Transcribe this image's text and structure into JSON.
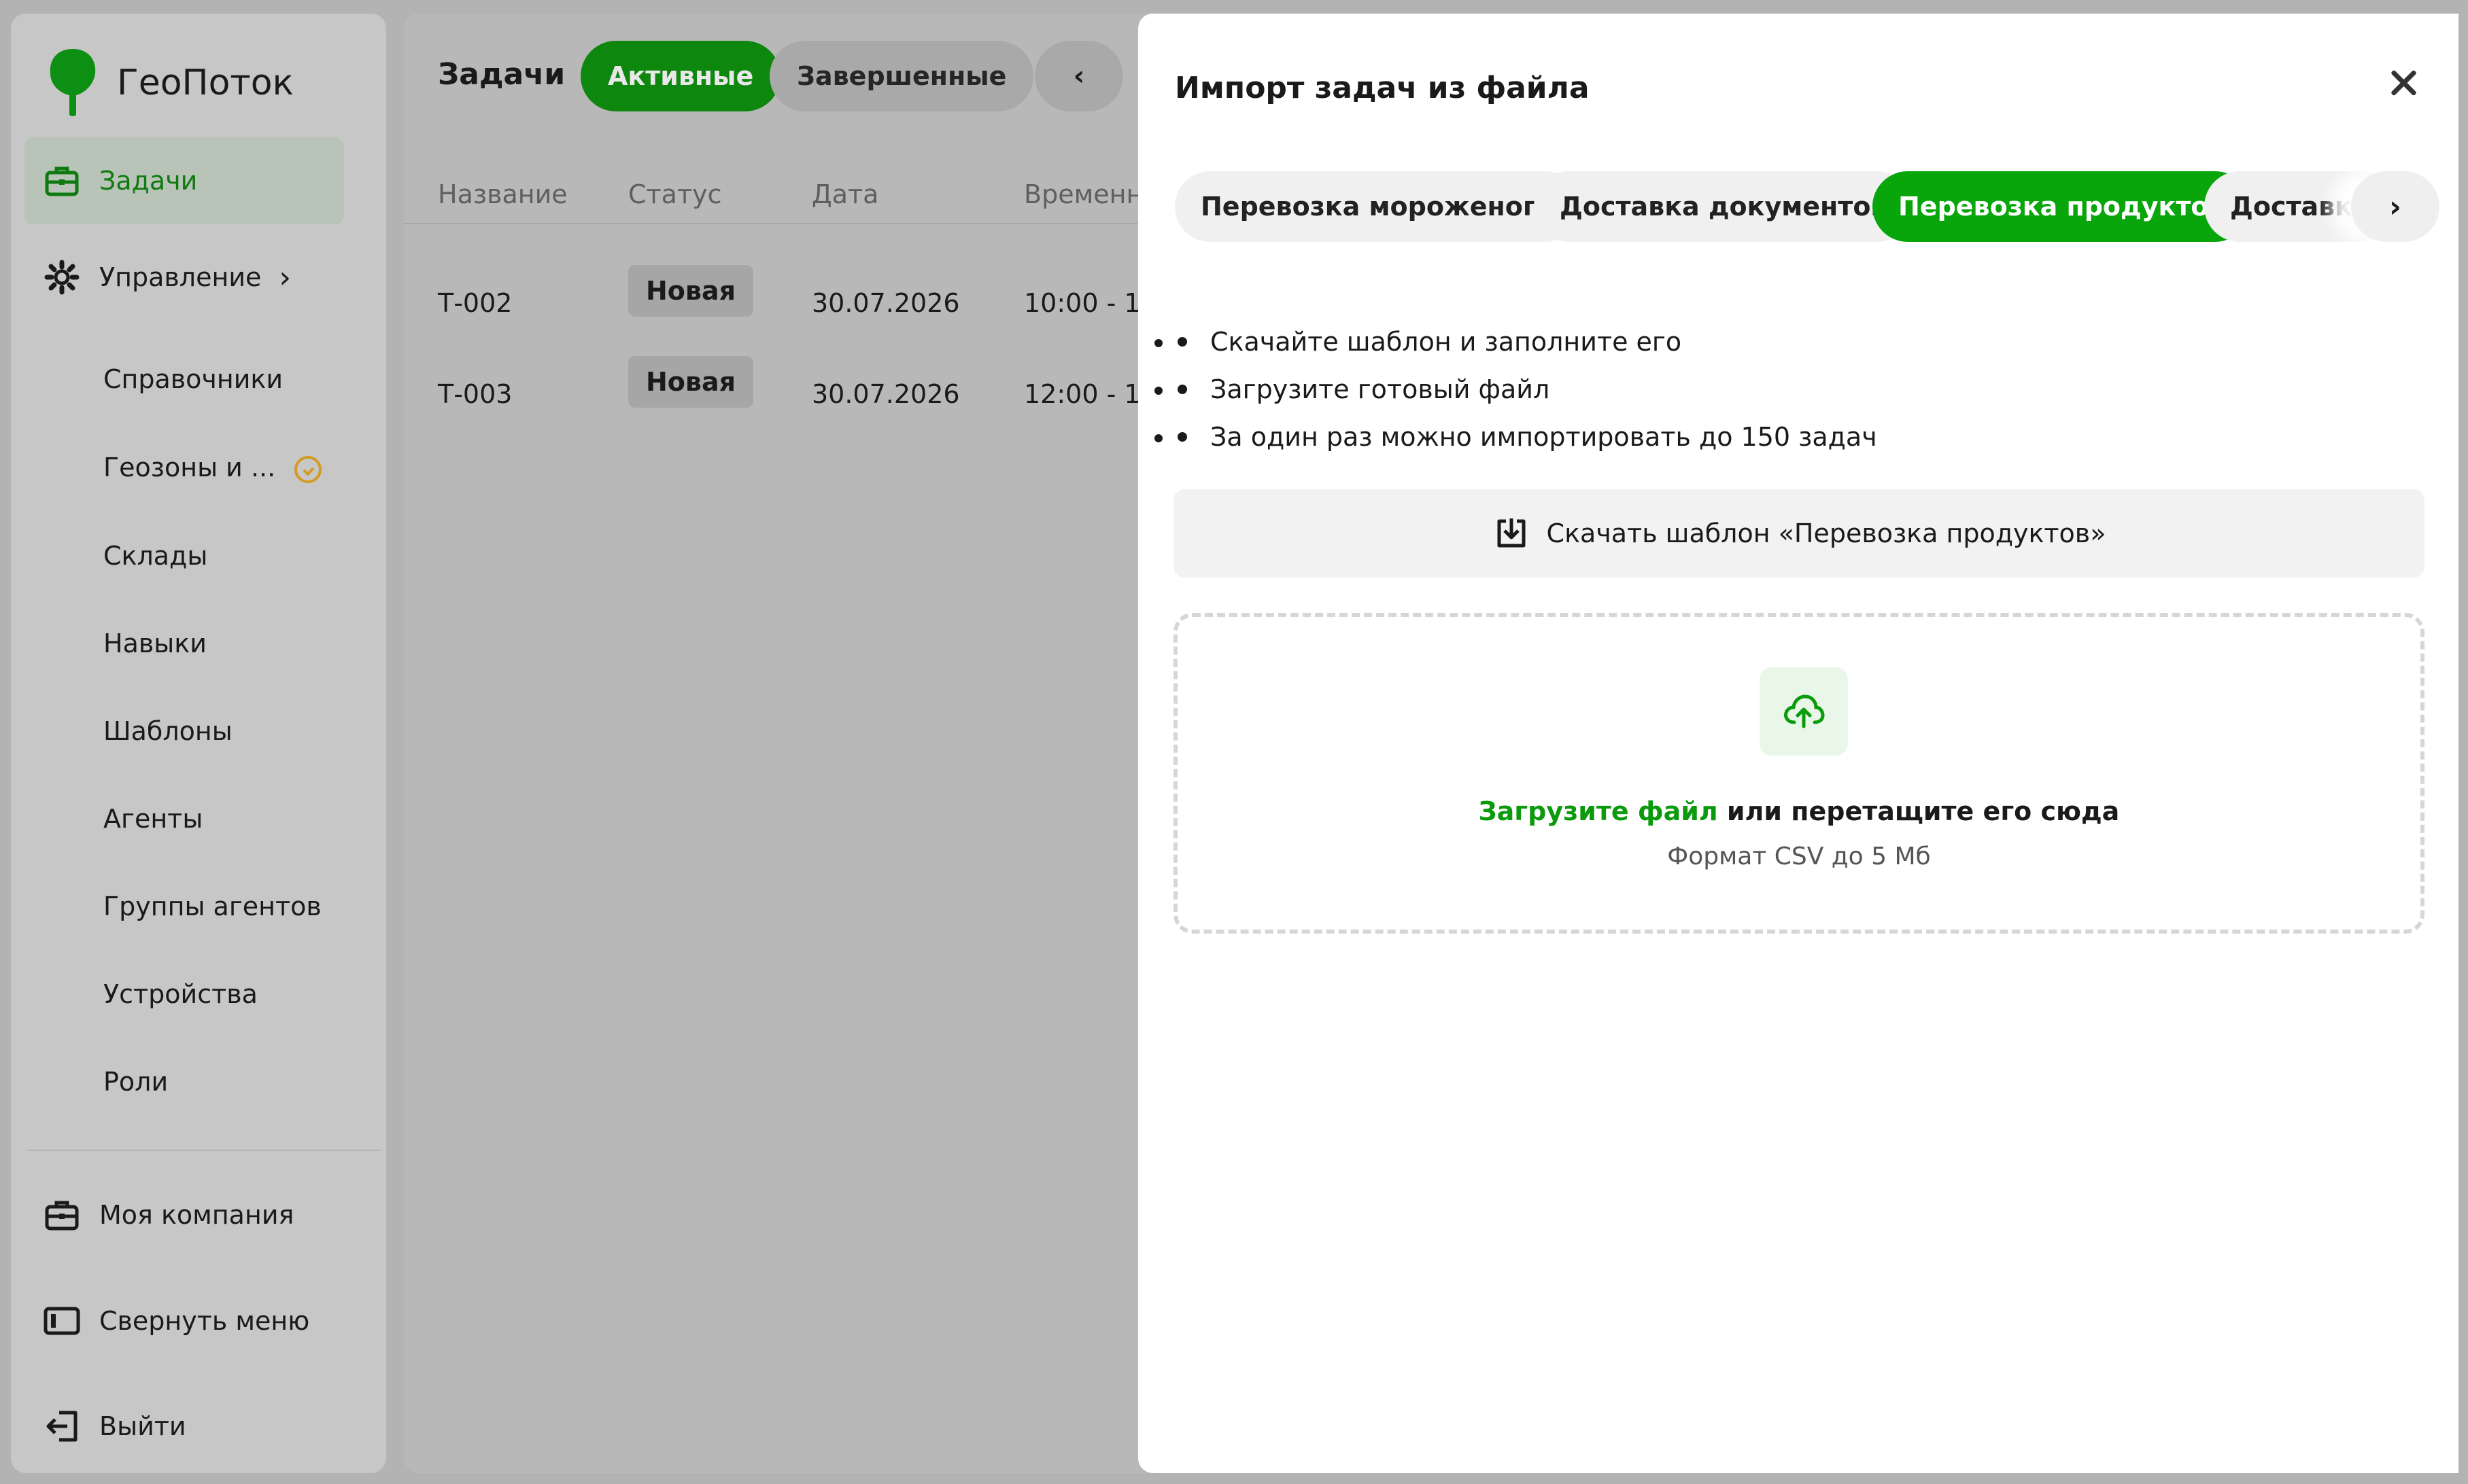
{
  "app": {
    "name": "ГеоПоток",
    "accent_color": "#08a60a"
  },
  "sidebar": {
    "items": [
      {
        "label": "Задачи",
        "icon": "briefcase-icon",
        "active": true
      },
      {
        "label": "Управление",
        "icon": "gear-icon",
        "expandable": true
      }
    ],
    "sub_items": [
      {
        "label": "Справочники"
      },
      {
        "label": "Геозоны и ...",
        "icon": "clock-warning-icon"
      },
      {
        "label": "Склады"
      },
      {
        "label": "Навыки"
      },
      {
        "label": "Шаблоны"
      },
      {
        "label": "Агенты"
      },
      {
        "label": "Группы агентов"
      },
      {
        "label": "Устройства"
      },
      {
        "label": "Роли"
      }
    ],
    "bottom_items": [
      {
        "label": "Моя компания",
        "icon": "briefcase-icon"
      },
      {
        "label": "Свернуть меню",
        "icon": "collapse-panel-icon"
      },
      {
        "label": "Выйти",
        "icon": "logout-icon"
      }
    ]
  },
  "main": {
    "title": "Задачи",
    "tabs": [
      {
        "label": "Активные",
        "active": true
      },
      {
        "label": "Завершенные"
      }
    ],
    "prev_label": "‹",
    "columns": [
      "Название",
      "Статус",
      "Дата",
      "Временн"
    ],
    "rows": [
      {
        "name": "Т-002",
        "status": "Новая",
        "date": "30.07.2026",
        "time": "10:00 - 1"
      },
      {
        "name": "Т-003",
        "status": "Новая",
        "date": "30.07.2026",
        "time": "12:00 - 1"
      }
    ]
  },
  "modal": {
    "title": "Импорт задач из файла",
    "tabs": [
      {
        "label": "Перевозка мороженого"
      },
      {
        "label": "Доставка документов"
      },
      {
        "label": "Перевозка продуктов",
        "active": true
      },
      {
        "label": "Доставка"
      }
    ],
    "next_label": "›",
    "instructions": [
      "Скачайте шаблон и заполните его",
      "Загрузите готовый файл",
      "За один раз можно импортировать до 150 задач"
    ],
    "download_label": "Скачать шаблон «Перевозка продуктов»",
    "dropzone": {
      "link_label": "Загрузите файл",
      "text_rest": " или перетащите его сюда",
      "hint": "Формат CSV до 5 Мб"
    }
  }
}
